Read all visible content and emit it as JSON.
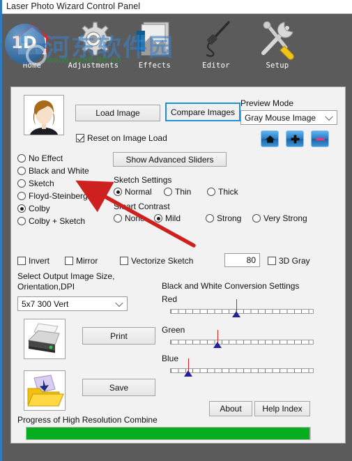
{
  "window": {
    "title": "Laser Photo Wizard Control Panel"
  },
  "watermark": {
    "text": "河东软件园",
    "sub": "www.cn86-90.cn",
    "logo_label": "1D"
  },
  "toolbar": {
    "items": [
      {
        "label": "Home",
        "icon": "house-icon"
      },
      {
        "label": "Adjustments",
        "icon": "gear-icon"
      },
      {
        "label": "Effects",
        "icon": "photo-stack-icon"
      },
      {
        "label": "Editor",
        "icon": "airbrush-pen-icon"
      },
      {
        "label": "Setup",
        "icon": "wrench-screwdriver-icon"
      }
    ]
  },
  "image_section": {
    "thumbnail_alt": "woman-portrait-thumbnail",
    "load_image_label": "Load Image",
    "compare_images_label": "Compare Images",
    "reset_on_image_load": {
      "label": "Reset on Image Load",
      "checked": true
    }
  },
  "preview": {
    "label": "Preview Mode",
    "selected": "Gray Mouse Image",
    "options": [
      "Gray Mouse Image"
    ],
    "buttons": [
      {
        "name": "home-view-button",
        "icon": "home-icon"
      },
      {
        "name": "zoom-in-button",
        "icon": "plus-icon"
      },
      {
        "name": "zoom-out-button",
        "icon": "minus-icon"
      }
    ]
  },
  "effects": {
    "selected": "Colby",
    "options": [
      "No Effect",
      "Black and White",
      "Sketch",
      "Floyd-Steinberg",
      "Colby",
      "Colby + Sketch"
    ]
  },
  "advanced": {
    "show_advanced_sliders_label": "Show Advanced Sliders"
  },
  "sketch_settings": {
    "title": "Sketch Settings",
    "selected": "Normal",
    "options": [
      "Normal",
      "Thin",
      "Thick"
    ]
  },
  "smart_contrast": {
    "title": "Smart Contrast",
    "selected": "Mild",
    "options": [
      "None",
      "Mild",
      "Strong",
      "Very Strong"
    ]
  },
  "toggles": {
    "invert": {
      "label": "Invert",
      "checked": false
    },
    "mirror": {
      "label": "Mirror",
      "checked": false
    },
    "vectorize_sketch": {
      "label": "Vectorize Sketch",
      "checked": false
    },
    "threshold_value": "80",
    "three_d_gray": {
      "label": "3D Gray",
      "checked": false
    }
  },
  "output": {
    "label_line1": "Select Output Image Size,",
    "label_line2": "Orientation,DPI",
    "selected": "5x7 300 Vert",
    "options": [
      "5x7 300 Vert"
    ]
  },
  "bw_conversion": {
    "title": "Black and White Conversion Settings",
    "channels": [
      {
        "label": "Red",
        "value": 55
      },
      {
        "label": "Green",
        "value": 36
      },
      {
        "label": "Blue",
        "value": 12
      }
    ]
  },
  "actions": {
    "print_label": "Print",
    "print_icon": "printer-icon",
    "save_label": "Save",
    "save_icon": "save-folder-icon",
    "about_label": "About",
    "help_index_label": "Help Index"
  },
  "progress": {
    "label": "Progress of High Resolution Combine",
    "percent": 100,
    "color": "#06ad1f"
  }
}
